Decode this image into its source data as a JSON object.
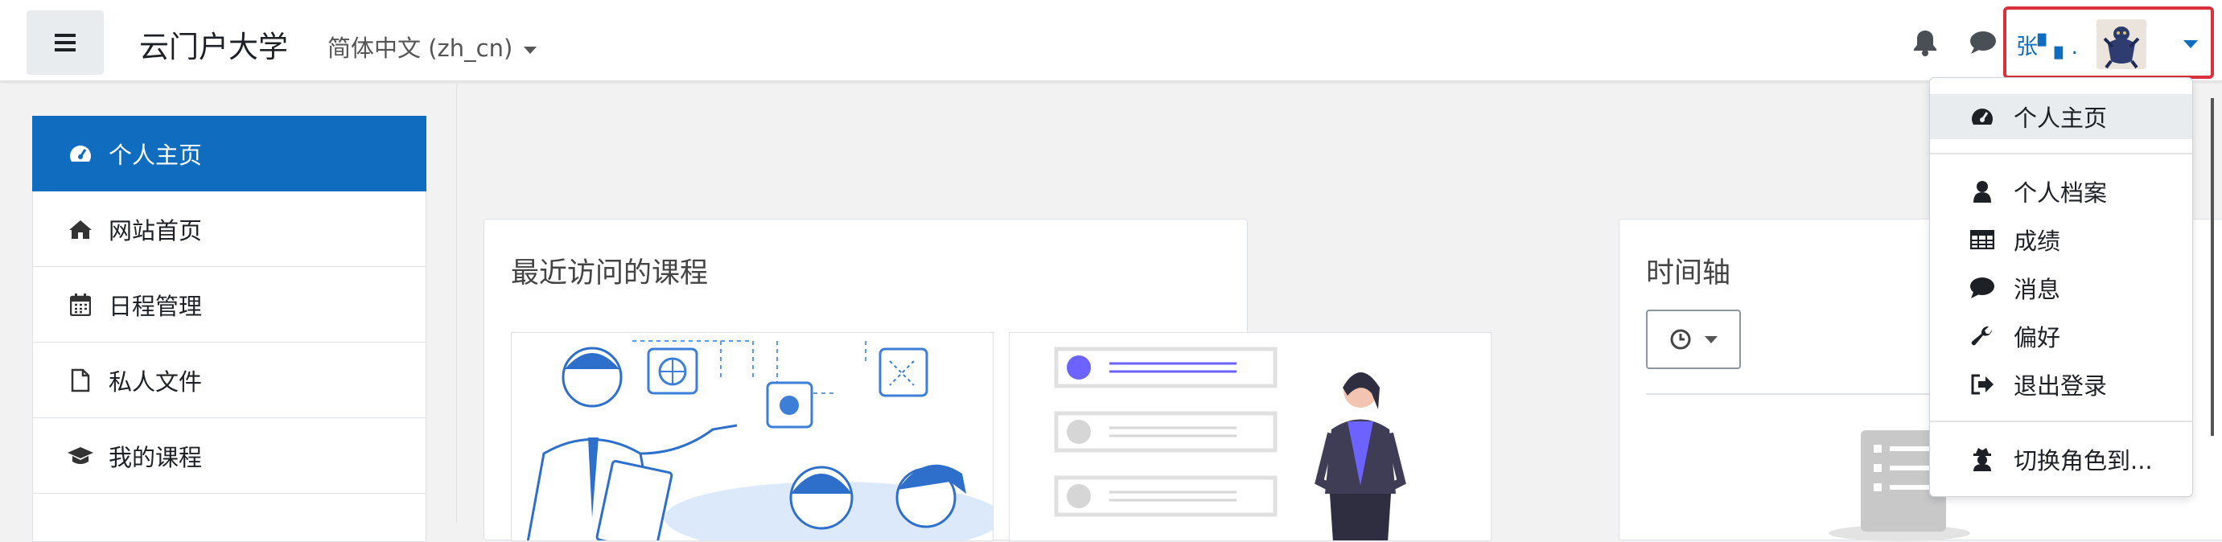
{
  "header": {
    "site_name": "云门户大学",
    "language": "简体中文 (zh_cn)",
    "username": "张▘▖.",
    "colors": {
      "accent": "#0f6cbf",
      "highlight_border": "#d9303c"
    }
  },
  "sidebar": {
    "items": [
      {
        "label": "个人主页",
        "icon": "dashboard-icon",
        "active": true
      },
      {
        "label": "网站首页",
        "icon": "home-icon"
      },
      {
        "label": "日程管理",
        "icon": "calendar-icon"
      },
      {
        "label": "私人文件",
        "icon": "file-icon"
      },
      {
        "label": "我的课程",
        "icon": "graduation-cap-icon"
      }
    ]
  },
  "main": {
    "recent_courses_title": "最近访问的课程",
    "timeline_title": "时间轴"
  },
  "user_menu": {
    "items": [
      {
        "label": "个人主页",
        "icon": "dashboard-icon"
      },
      {
        "label": "个人档案",
        "icon": "user-icon"
      },
      {
        "label": "成绩",
        "icon": "table-icon"
      },
      {
        "label": "消息",
        "icon": "comment-icon"
      },
      {
        "label": "偏好",
        "icon": "wrench-icon"
      },
      {
        "label": "退出登录",
        "icon": "sign-out-icon"
      },
      {
        "label": "切换角色到...",
        "icon": "user-secret-icon"
      }
    ]
  }
}
